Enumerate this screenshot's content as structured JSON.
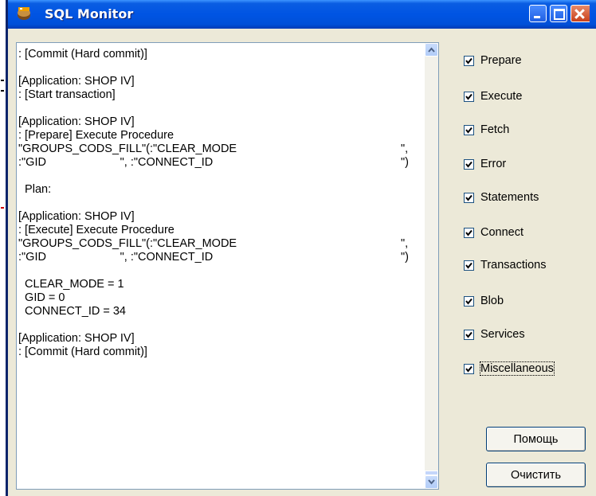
{
  "window": {
    "title": "SQL Monitor"
  },
  "log": {
    "lines": [
      {
        "l": ": [Commit (Hard commit)]",
        "r": ""
      },
      {
        "l": "",
        "r": ""
      },
      {
        "l": "[Application: SHOP IV]",
        "r": ""
      },
      {
        "l": ": [Start transaction]",
        "r": ""
      },
      {
        "l": "",
        "r": ""
      },
      {
        "l": "[Application: SHOP IV]",
        "r": ""
      },
      {
        "l": ": [Prepare] Execute Procedure",
        "r": ""
      },
      {
        "l": "\"GROUPS_CODS_FILL\"(:\"CLEAR_MODE",
        "r": "\","
      },
      {
        "l": ":\"GID                       \", :\"CONNECT_ID",
        "r": "\")"
      },
      {
        "l": "",
        "r": ""
      },
      {
        "l": "  Plan:",
        "r": ""
      },
      {
        "l": "",
        "r": ""
      },
      {
        "l": "[Application: SHOP IV]",
        "r": ""
      },
      {
        "l": ": [Execute] Execute Procedure",
        "r": ""
      },
      {
        "l": "\"GROUPS_CODS_FILL\"(:\"CLEAR_MODE",
        "r": "\","
      },
      {
        "l": ":\"GID                       \", :\"CONNECT_ID",
        "r": "\")"
      },
      {
        "l": "",
        "r": ""
      },
      {
        "l": "  CLEAR_MODE = 1",
        "r": ""
      },
      {
        "l": "  GID = 0",
        "r": ""
      },
      {
        "l": "  CONNECT_ID = 34",
        "r": ""
      },
      {
        "l": "",
        "r": ""
      },
      {
        "l": "[Application: SHOP IV]",
        "r": ""
      },
      {
        "l": ": [Commit (Hard commit)]",
        "r": ""
      }
    ]
  },
  "options": [
    {
      "label": "Prepare",
      "checked": true
    },
    {
      "label": "Execute",
      "checked": true
    },
    {
      "label": "Fetch",
      "checked": true
    },
    {
      "label": "Error",
      "checked": true
    },
    {
      "label": "Statements",
      "checked": true
    },
    {
      "label": "Connect",
      "checked": true
    },
    {
      "label": "Transactions",
      "checked": true
    },
    {
      "label": "Blob",
      "checked": true
    },
    {
      "label": "Services",
      "checked": true
    },
    {
      "label": "Miscellaneous",
      "checked": true
    }
  ],
  "buttons": {
    "help": "Помощь",
    "clear": "Очистить"
  },
  "colors": {
    "titlebar": "#0054e3",
    "face": "#ece9d8"
  }
}
